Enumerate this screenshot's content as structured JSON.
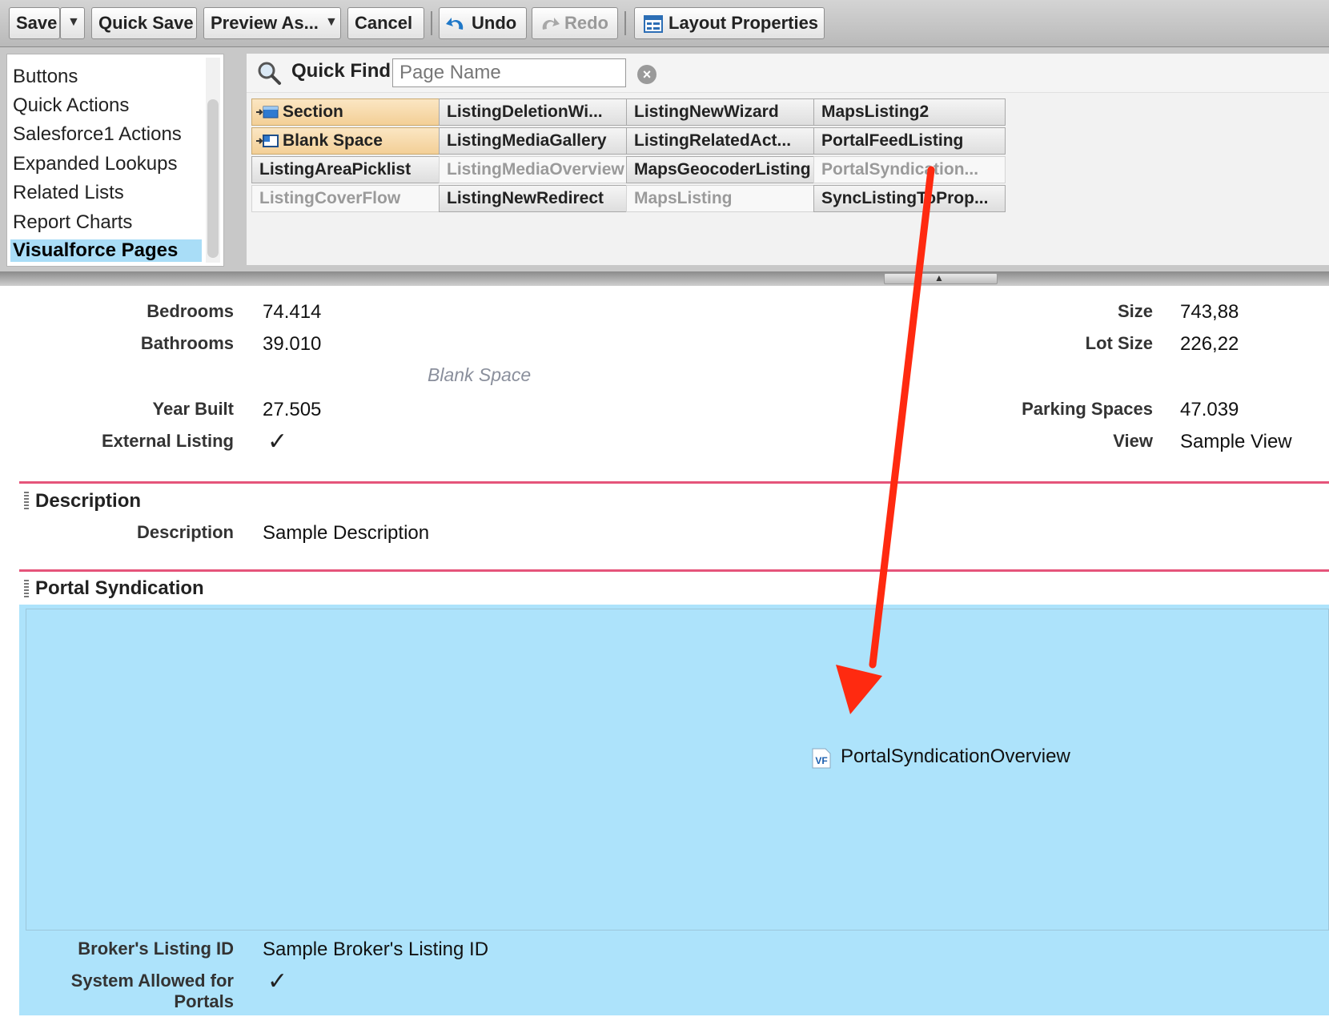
{
  "toolbar": {
    "save": "Save",
    "quick_save": "Quick Save",
    "preview_as": "Preview As...",
    "cancel": "Cancel",
    "undo": "Undo",
    "redo": "Redo",
    "layout_properties": "Layout Properties"
  },
  "palette": {
    "categories": [
      "Buttons",
      "Quick Actions",
      "Salesforce1 Actions",
      "Expanded Lookups",
      "Related Lists",
      "Report Charts",
      "Visualforce Pages"
    ],
    "selected_category": "Visualforce Pages",
    "quick_find": {
      "label": "Quick Find",
      "placeholder": "Page Name",
      "value": ""
    },
    "items": [
      [
        "Section",
        "ListingDeletionWi...",
        "ListingNewWizard",
        "MapsListing2"
      ],
      [
        "Blank Space",
        "ListingMediaGallery",
        "ListingRelatedAct...",
        "PortalFeedListing"
      ],
      [
        "ListingAreaPicklist",
        "ListingMediaOverview",
        "MapsGeocoderListing",
        "PortalSyndication..."
      ],
      [
        "ListingCoverFlow",
        "ListingNewRedirect",
        "MapsListing",
        "SyncListingToProp..."
      ]
    ]
  },
  "fields": {
    "bedrooms": {
      "label": "Bedrooms",
      "value": "74.414"
    },
    "bathrooms": {
      "label": "Bathrooms",
      "value": "39.010"
    },
    "year_built": {
      "label": "Year Built",
      "value": "27.505"
    },
    "external_listing": {
      "label": "External Listing",
      "checked": true
    },
    "size": {
      "label": "Size",
      "value": "743,88"
    },
    "lot_size": {
      "label": "Lot Size",
      "value": "226,22"
    },
    "parking_spaces": {
      "label": "Parking Spaces",
      "value": "47.039"
    },
    "view": {
      "label": "View",
      "value": "Sample View"
    },
    "blank_space": "Blank Space"
  },
  "description_section": {
    "title": "Description",
    "label": "Description",
    "value": "Sample Description"
  },
  "portal_section": {
    "title": "Portal Syndication",
    "visualforce_page": "PortalSyndicationOverview",
    "vf_badge": "VF",
    "brokers_listing_id": {
      "label": "Broker's Listing ID",
      "value": "Sample Broker's Listing ID"
    },
    "system_allowed_line1": "System Allowed for",
    "system_allowed_line2": "Portals",
    "system_allowed_checked": true
  },
  "colors": {
    "section_rule": "#e5547a",
    "vf_zone": "#ade3fb",
    "selected_category": "#a9ddf7",
    "annotation_arrow": "#ff2a10"
  }
}
